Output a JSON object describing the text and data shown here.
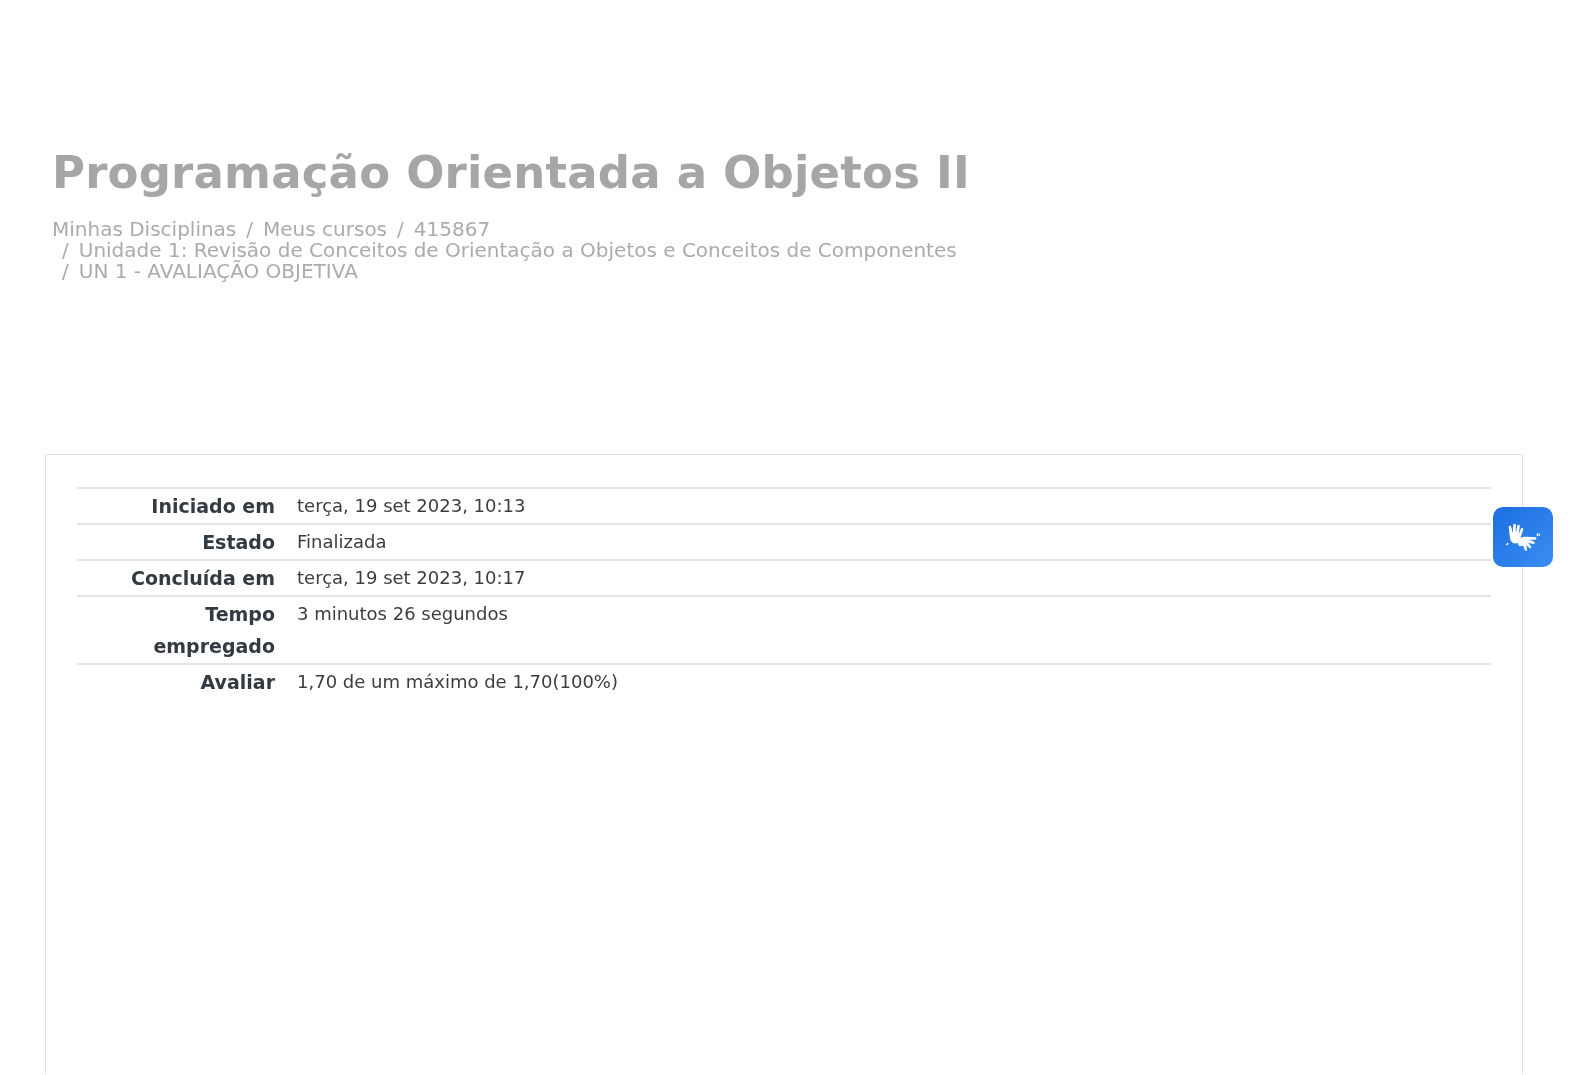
{
  "page": {
    "title": "Programação Orientada a Objetos II"
  },
  "breadcrumb": [
    {
      "label": "Minhas Disciplinas"
    },
    {
      "separator": "/",
      "label": "Meus cursos"
    },
    {
      "separator": "/",
      "label": "415867"
    },
    {
      "separator": "/",
      "label": "Unidade 1: Revisão de Conceitos de Orientação a Objetos e Conceitos de Componentes"
    },
    {
      "separator": "/",
      "label": "UN 1 - AVALIAÇÃO OBJETIVA"
    }
  ],
  "summary": {
    "rows": [
      {
        "label": "Iniciado em",
        "value": "terça, 19 set 2023, 10:13"
      },
      {
        "label": "Estado",
        "value": "Finalizada"
      },
      {
        "label": "Concluída em",
        "value": "terça, 19 set 2023, 10:17"
      },
      {
        "label": "Tempo empregado",
        "value": "3 minutos 26 segundos"
      },
      {
        "label": "Avaliar",
        "value": "1,70 de um máximo de 1,70(100%)"
      }
    ]
  }
}
